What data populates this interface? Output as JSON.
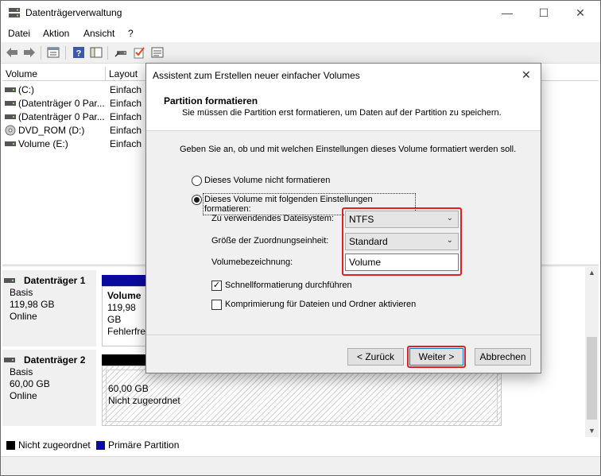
{
  "window": {
    "title": "Datenträgerverwaltung",
    "minimize": "—",
    "maximize": "☐",
    "close": "✕"
  },
  "menu": [
    "Datei",
    "Aktion",
    "Ansicht",
    "?"
  ],
  "toolbar_icons": [
    "back-arrow-icon",
    "forward-arrow-icon",
    "properties-icon",
    "help-icon",
    "console-tree-icon",
    "connect-disk-icon",
    "check-icon",
    "settings-list-icon"
  ],
  "volume_list": {
    "columns": [
      "Volume",
      "Layout"
    ],
    "rows": [
      {
        "volume": "(C:)",
        "layout": "Einfach",
        "icon": "drive-icon"
      },
      {
        "volume": "(Datenträger 0 Par...",
        "layout": "Einfach",
        "icon": "drive-icon"
      },
      {
        "volume": "(Datenträger 0 Par...",
        "layout": "Einfach",
        "icon": "drive-icon"
      },
      {
        "volume": "DVD_ROM (D:)",
        "layout": "Einfach",
        "icon": "dvd-icon"
      },
      {
        "volume": "Volume (E:)",
        "layout": "Einfach",
        "icon": "drive-icon"
      }
    ]
  },
  "disks": [
    {
      "name": "Datenträger 1",
      "type": "Basis",
      "size": "119,98 GB",
      "status": "Online",
      "partition": {
        "name": "Volume",
        "size": "119,98 GB",
        "status": "Fehlerfrei"
      }
    },
    {
      "name": "Datenträger 2",
      "type": "Basis",
      "size": "60,00 GB",
      "status": "Online",
      "partition": {
        "size": "60,00 GB",
        "status": "Nicht zugeordnet"
      }
    }
  ],
  "legend": [
    {
      "label": "Nicht zugeordnet",
      "color": "#000000"
    },
    {
      "label": "Primäre Partition",
      "color": "#0a0aa0"
    }
  ],
  "dialog": {
    "title": "Assistent zum Erstellen neuer einfacher Volumes",
    "close": "✕",
    "header_title": "Partition formatieren",
    "header_subtitle": "Sie müssen die Partition erst formatieren, um Daten auf der Partition zu speichern.",
    "instruction": "Geben Sie an, ob und mit welchen Einstellungen dieses Volume formatiert werden soll.",
    "option_no_format": "Dieses Volume nicht formatieren",
    "option_format": "Dieses Volume mit folgenden Einstellungen formatieren:",
    "selected_option": "format",
    "filesystem_label": "Zu verwendendes Dateisystem:",
    "filesystem_value": "NTFS",
    "alloc_label": "Größe der Zuordnungseinheit:",
    "alloc_value": "Standard",
    "volume_label_label": "Volumebezeichnung:",
    "volume_label_value": "Volume",
    "quick_format_label": "Schnellformatierung durchführen",
    "quick_format_checked": true,
    "compression_label": "Komprimierung für Dateien und Ordner aktivieren",
    "compression_checked": false,
    "back_button": "< Zurück",
    "next_button": "Weiter >",
    "cancel_button": "Abbrechen",
    "highlight_color": "#e02020"
  }
}
